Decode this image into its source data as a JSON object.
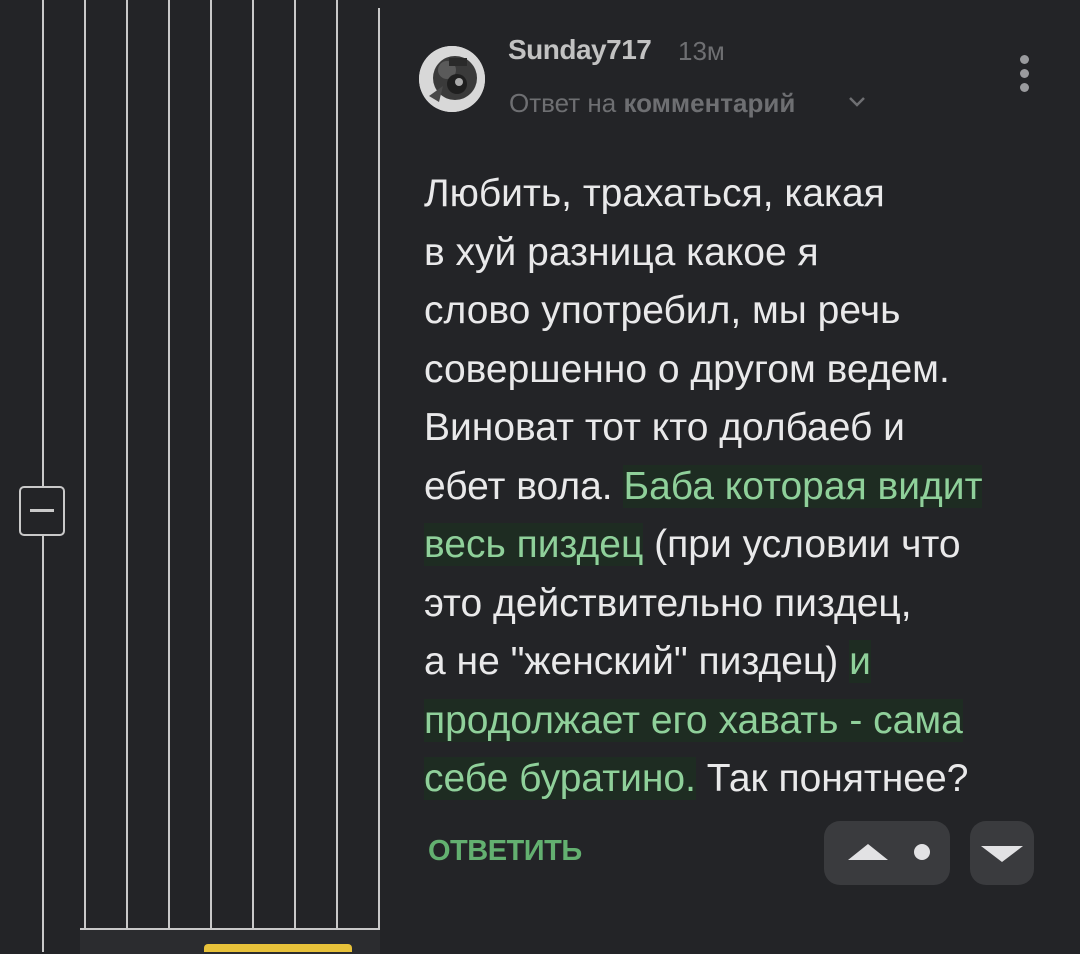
{
  "comment": {
    "author": "Sunday717",
    "time": "13м",
    "reply_prefix": "Ответ на",
    "reply_target": "комментарий",
    "body_lines": [
      [
        {
          "text": "Любить, трахаться, какая"
        }
      ],
      [
        {
          "text": "в хуй разница какое я"
        }
      ],
      [
        {
          "text": "слово употребил, мы речь"
        }
      ],
      [
        {
          "text": "совершенно о другом ведем."
        }
      ],
      [
        {
          "text": "Виноват тот кто долбаеб и"
        }
      ],
      [
        {
          "text": "ебет вола. "
        },
        {
          "text": "Баба которая видит",
          "hl": true
        }
      ],
      [
        {
          "text": "весь пиздец",
          "hl": true
        },
        {
          "text": " (при условии что"
        }
      ],
      [
        {
          "text": "это действительно пиздец,"
        }
      ],
      [
        {
          "text": "а не \"женский\" пиздец) "
        },
        {
          "text": "и",
          "hl": true
        }
      ],
      [
        {
          "text": "продолжает его хавать - сама",
          "hl": true
        }
      ],
      [
        {
          "text": "себе буратино.",
          "hl": true
        },
        {
          "text": " Так понятнее?"
        }
      ]
    ]
  },
  "actions": {
    "reply_label": "ОТВЕТИТЬ"
  },
  "icons": {
    "collapse": "minus-icon",
    "menu": "kebab-menu-icon",
    "upvote": "triangle-up-icon",
    "downvote": "triangle-down-icon",
    "expand": "chevron-down-icon"
  },
  "colors": {
    "background": "#232427",
    "text": "#e9e9ea",
    "highlight_text": "#8fd09a",
    "accent": "#63b070",
    "muted": "#6e6f72"
  }
}
